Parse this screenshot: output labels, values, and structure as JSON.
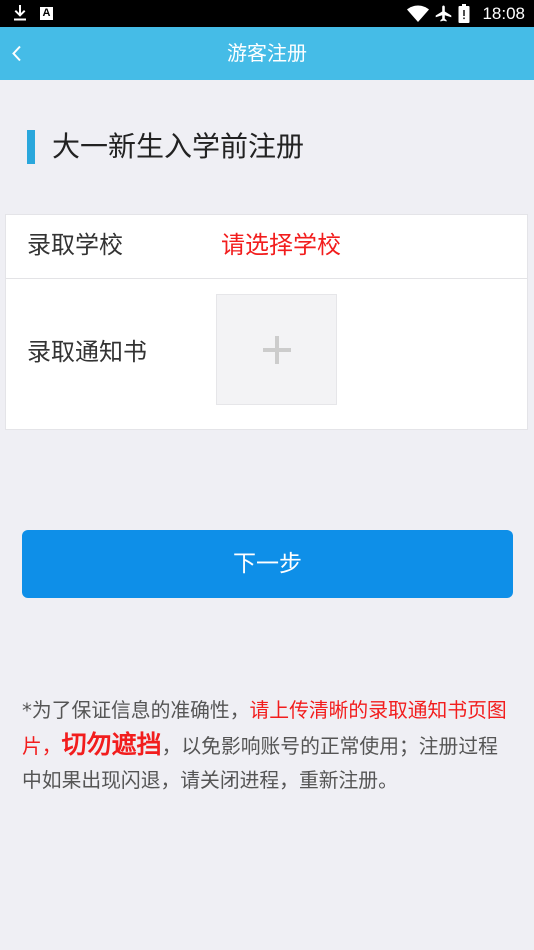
{
  "status_bar": {
    "time": "18:08",
    "app_icon_letter": "A",
    "icons": [
      "download-icon",
      "app-notification-icon",
      "wifi-icon",
      "airplane-mode-icon",
      "battery-icon"
    ]
  },
  "header": {
    "title": "游客注册",
    "back_icon": "chevron-left-icon"
  },
  "section": {
    "title": "大一新生入学前注册"
  },
  "form": {
    "school": {
      "label": "录取学校",
      "placeholder": "请选择学校"
    },
    "admission_letter": {
      "label": "录取通知书",
      "upload_icon": "plus-icon"
    }
  },
  "next_button": {
    "label": "下一步"
  },
  "notice": {
    "intro": "*为了保证信息的准确性，",
    "highlight": "请上传清晰的录取通知书页图片，",
    "emphasis": "切勿遮挡",
    "rest": "，以免影响账号的正常使用；注册过程中如果出现闪退，请关闭进程，重新注册。"
  },
  "colors": {
    "status_bar": "#000000",
    "header": "#45BCE7",
    "accent_bar": "#2AA7DC",
    "page_background": "#EFEFF4",
    "button": "#0E8FE8",
    "alert_red": "#F21D1D",
    "notice_text": "#555555"
  }
}
